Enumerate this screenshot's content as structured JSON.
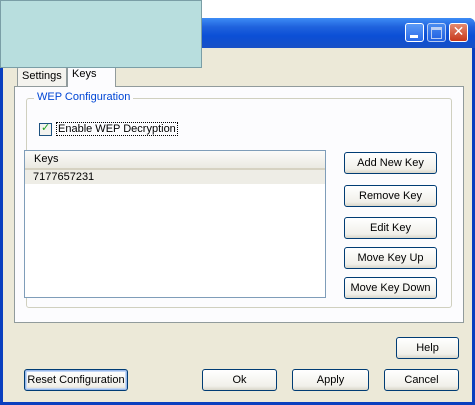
{
  "tabs": [
    {
      "label": "Settings"
    },
    {
      "label": "Keys"
    }
  ],
  "wep": {
    "group_title": "WEP Configuration",
    "enable_label": "Enable WEP Decryption",
    "enabled": true
  },
  "keys_list": {
    "header": "Keys",
    "rows": [
      "7177657231"
    ]
  },
  "side_buttons": {
    "add": "Add New Key",
    "remove": "Remove Key",
    "edit": "Edit Key",
    "up": "Move Key Up",
    "down": "Move Key Down"
  },
  "bottom_buttons": {
    "help": "Help",
    "reset": "Reset Configuration",
    "ok": "Ok",
    "apply": "Apply",
    "cancel": "Cancel"
  },
  "colors": {
    "titlebar": "#0b4fd6",
    "dialog_bg": "#ece9d8",
    "group_title": "#0046d5",
    "overlay": "#b8dede"
  },
  "icons": {
    "minimize": "minimize-icon",
    "maximize": "maximize-icon",
    "close": "close-icon"
  }
}
